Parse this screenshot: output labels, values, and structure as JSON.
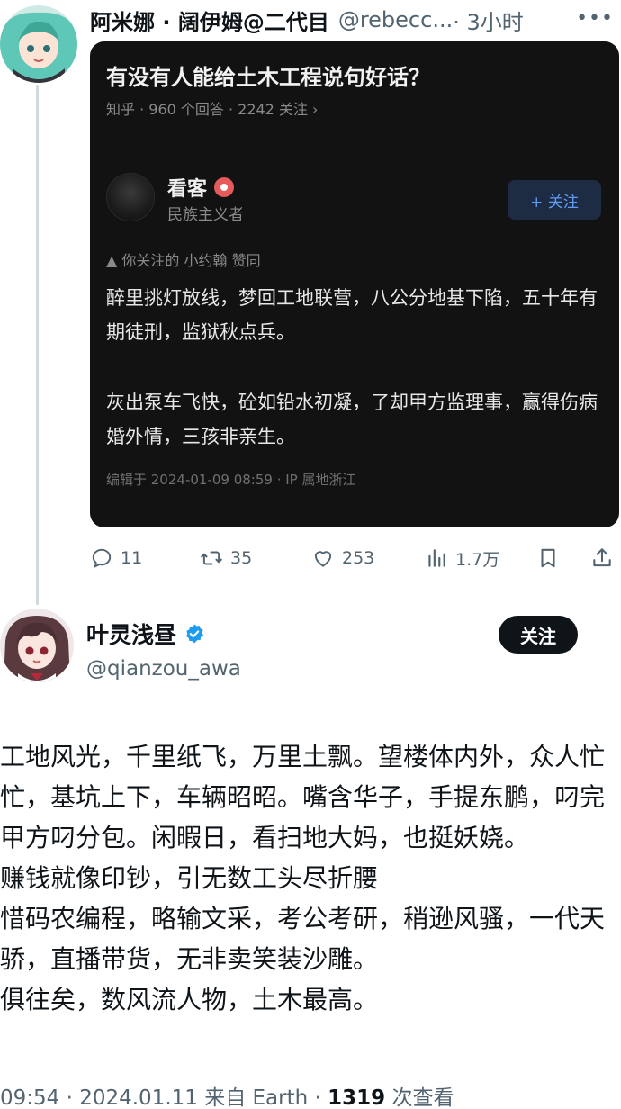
{
  "parent_tweet": {
    "display_name": "阿米娜 · 阔伊姆@二代目",
    "handle": "@rebecc...",
    "time": "· 3小时",
    "more_icon": "more-horizontal-icon",
    "zhihu_card": {
      "question": "有没有人能给土木工程说句好话？",
      "meta": "知乎 · 960 个回答 · 2242 关注 ›",
      "author_name": "看客",
      "author_desc": "民族主义者",
      "follow_label": "+ 关注",
      "upvote_note": "▲ 你关注的 小约翰 赞同",
      "paragraph_1": "醉里挑灯放线，梦回工地联营，八公分地基下陷，五十年有期徒刑，监狱秋点兵。",
      "paragraph_2": "灰出泵车飞快，砼如铅水初凝，了却甲方监理事，赢得伤病婚外情，三孩非亲生。",
      "edit_info": "编辑于 2024-01-09 08:59 · IP 属地浙江"
    },
    "actions": {
      "replies": "11",
      "retweets": "35",
      "likes": "253",
      "views": "1.7万"
    }
  },
  "main_tweet": {
    "display_name": "叶灵浅昼",
    "handle": "@qianzou_awa",
    "follow_label": "关注",
    "body": "工地风光，千里纸飞，万里土飘。望楼体内外，众人忙忙，基坑上下，车辆昭昭。嘴含华子，手提东鹏，叼完甲方叼分包。闲暇日，看扫地大妈，也挺妖娆。\n赚钱就像印钞，引无数工头尽折腰\n惜码农编程，略输文采，考公考研，稍逊风骚，一代天骄，直播带货，无非卖笑装沙雕。\n俱往矣，数风流人物，土木最高。",
    "footer_time": "09:54 · 2024.01.11 来自 Earth · ",
    "footer_views_count": "1319",
    "footer_views_label": " 次查看"
  },
  "colors": {
    "secondary_text": "#536471",
    "verified": "#1d9bf0",
    "zhihu_bg": "#121212",
    "zhihu_accent": "#5e9cf5"
  }
}
